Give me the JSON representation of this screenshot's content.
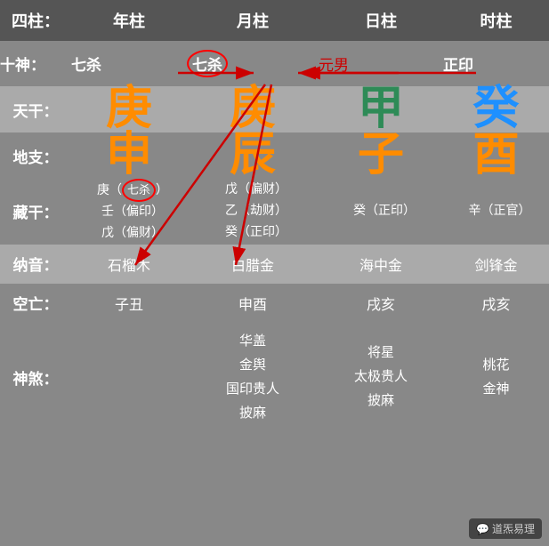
{
  "header": {
    "sizhu": "四柱：",
    "nian": "年柱",
    "yue": "月柱",
    "ri": "日柱",
    "shi": "时柱"
  },
  "shishen": {
    "label": "十神：",
    "nian": "七杀",
    "yue": "七杀",
    "ri": "元男",
    "shi": "正印"
  },
  "tiangan": {
    "label": "天干：",
    "nian": "庚",
    "yue": "庚",
    "ri": "甲",
    "shi": "癸",
    "nian_color": "orange",
    "yue_color": "orange",
    "ri_color": "green",
    "shi_color": "blue"
  },
  "dizhi": {
    "label": "地支：",
    "nian": "申",
    "yue": "辰",
    "ri": "子",
    "shi": "酉",
    "nian_color": "orange",
    "yue_color": "orange",
    "ri_color": "orange",
    "shi_color": "orange"
  },
  "zanggan": {
    "label": "藏干：",
    "nian_line1": "庚（七杀）",
    "nian_line2": "壬（偏印）",
    "nian_line3": "戊（偏财）",
    "yue_line1": "戊（偏财）",
    "yue_line2": "乙（劫财）",
    "yue_line3": "癸（正印）",
    "ri_line1": "癸（正印）",
    "shi_line1": "辛（正官）"
  },
  "nayin": {
    "label": "纳音：",
    "nian": "石榴木",
    "yue": "白腊金",
    "ri": "海中金",
    "shi": "剑锋金"
  },
  "kongwang": {
    "label": "空亡：",
    "nian": "子丑",
    "yue": "申酉",
    "ri": "戌亥",
    "shi": "戌亥"
  },
  "shenshar": {
    "label": "神煞：",
    "nian": "",
    "yue_line1": "华盖",
    "yue_line2": "金舆",
    "yue_line3": "国印贵人",
    "yue_line4": "披麻",
    "ri_line1": "将星",
    "ri_line2": "太极贵人",
    "ri_line3": "披麻",
    "shi_line1": "桃花",
    "shi_line2": "金神"
  },
  "wechat": "道炁易理"
}
